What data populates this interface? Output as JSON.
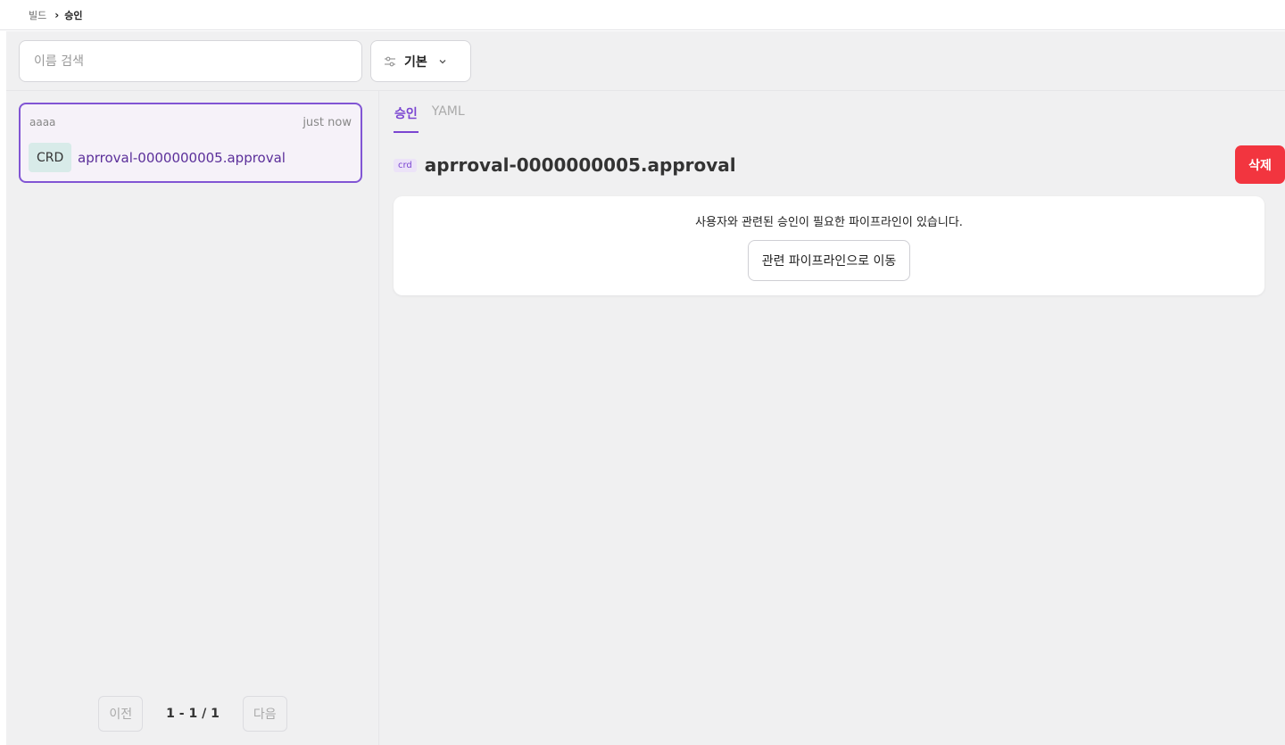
{
  "breadcrumb": {
    "root": "빌드",
    "separator": "›",
    "current": "승인"
  },
  "toolbar": {
    "search_placeholder": "이름 검색",
    "filter_label": "기본",
    "filter_icon": "sliders-icon",
    "dropdown_icon": "chevron-down-icon"
  },
  "list": {
    "items": [
      {
        "namespace": "aaaa",
        "time": "just now",
        "kind": "CRD",
        "name": "aprroval-0000000005.approval"
      }
    ],
    "pagination": {
      "prev_label": "이전",
      "info": "1 - 1 / 1",
      "next_label": "다음"
    }
  },
  "detail": {
    "tabs": [
      {
        "label": "승인",
        "active": true
      },
      {
        "label": "YAML",
        "active": false
      }
    ],
    "kind_badge": "crd",
    "title": "aprroval-0000000005.approval",
    "delete_label": "삭제",
    "notice": {
      "message": "사용자와 관련된 승인이 필요한 파이프라인이 있습니다.",
      "button_label": "관련 파이프라인으로 이동"
    }
  },
  "colors": {
    "accent": "#7a45d1",
    "danger": "#f2353f",
    "selected_bg": "#f6f2f9",
    "kind_bg": "#d8ebe9"
  }
}
